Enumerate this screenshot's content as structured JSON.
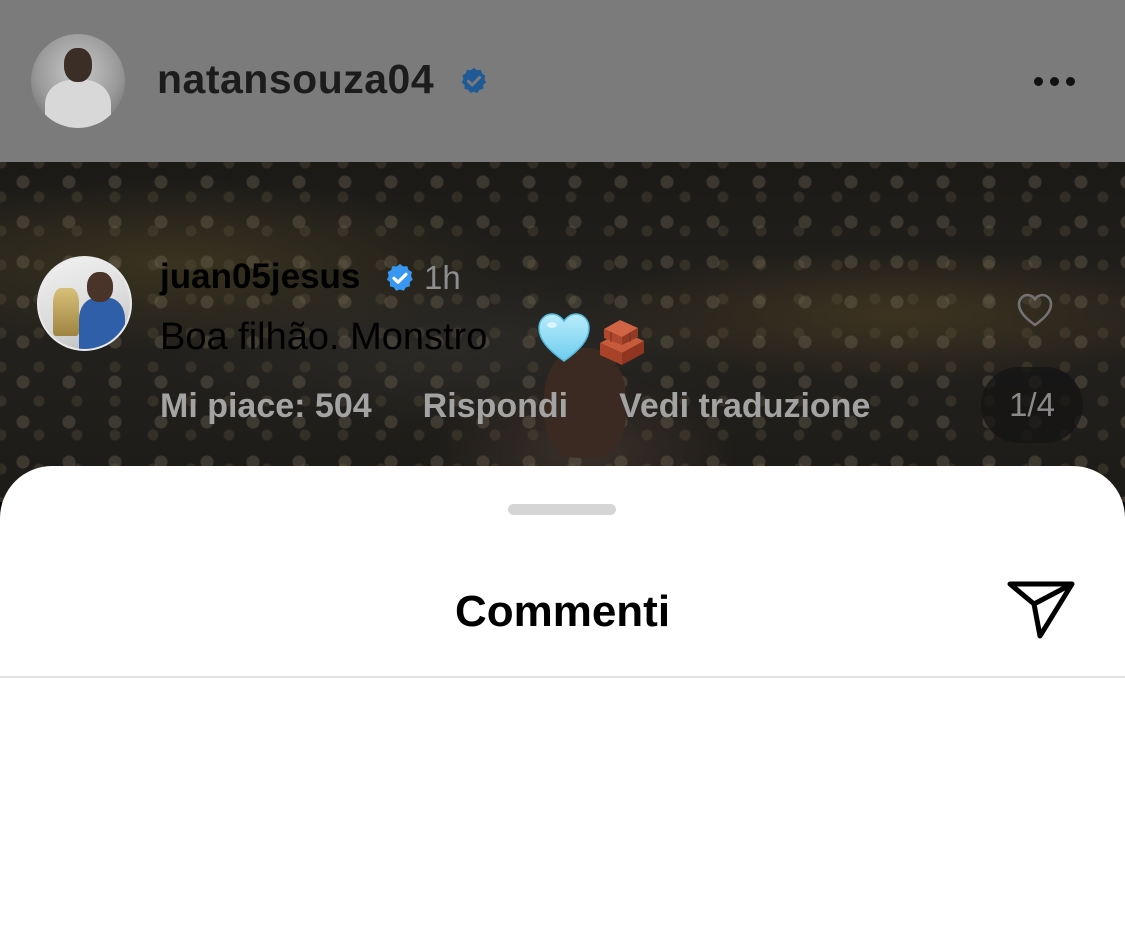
{
  "post": {
    "username": "natansouza04",
    "verified_icon": "verified-badge-icon",
    "more_icon": "more-horizontal-icon",
    "image_counter": "1/4"
  },
  "sheet": {
    "title": "Commenti",
    "send_icon": "send-icon"
  },
  "comments": [
    {
      "username": "juan05jesus",
      "verified": true,
      "time": "1h",
      "text": "Boa filhão. Monstro",
      "emojis": [
        "light-blue-heart",
        "brick"
      ],
      "like_icon": "heart-outline-icon",
      "actions": {
        "likes": "Mi piace: 504",
        "reply": "Rispondi",
        "translate": "Vedi traduzione"
      }
    }
  ],
  "colors": {
    "verified_blue": "#3897f0",
    "secondary_text": "#8e8e8e",
    "action_text": "#a3a3a3"
  }
}
